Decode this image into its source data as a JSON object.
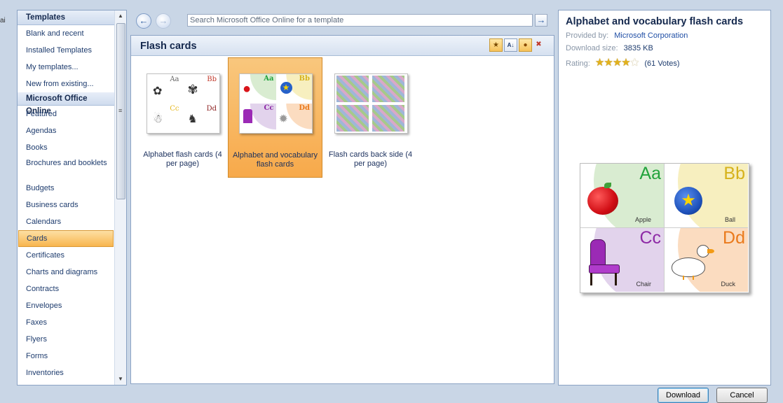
{
  "edge_text": "ai",
  "sidebar": {
    "header": "Templates",
    "items": [
      {
        "label": "Blank and recent"
      },
      {
        "label": "Installed Templates"
      },
      {
        "label": "My templates..."
      },
      {
        "label": "New from existing..."
      }
    ],
    "online_header": "Microsoft Office Online",
    "online_items": [
      {
        "label": "Featured"
      },
      {
        "label": "Agendas"
      },
      {
        "label": "Books"
      },
      {
        "label": "Brochures and booklets"
      },
      {
        "label": "Budgets"
      },
      {
        "label": "Business cards"
      },
      {
        "label": "Calendars"
      },
      {
        "label": "Cards",
        "selected": true
      },
      {
        "label": "Certificates"
      },
      {
        "label": "Charts and diagrams"
      },
      {
        "label": "Contracts"
      },
      {
        "label": "Envelopes"
      },
      {
        "label": "Faxes"
      },
      {
        "label": "Flyers"
      },
      {
        "label": "Forms"
      },
      {
        "label": "Inventories"
      }
    ]
  },
  "search": {
    "placeholder": "Search Microsoft Office Online for a template"
  },
  "gallery": {
    "title": "Flash cards",
    "templates": [
      {
        "label": "Alphabet flash cards (4 per page)",
        "selected": false
      },
      {
        "label": "Alphabet and vocabulary flash cards",
        "selected": true
      },
      {
        "label": "Flash cards back side (4 per page)",
        "selected": false
      }
    ]
  },
  "detail": {
    "title": "Alphabet and vocabulary flash cards",
    "provided_by_label": "Provided by:",
    "provided_by": "Microsoft Corporation",
    "download_size_label": "Download size:",
    "download_size": "3835 KB",
    "rating_label": "Rating:",
    "rating_value": 4,
    "rating_max": 5,
    "votes": "(61 Votes)",
    "preview_cards": [
      {
        "letter": "Aa",
        "word": "Apple",
        "color": "#22a33c",
        "arc": "#d9ecd1"
      },
      {
        "letter": "Bb",
        "word": "Ball",
        "color": "#d6b21c",
        "arc": "#f7efbf"
      },
      {
        "letter": "Cc",
        "word": "Chair",
        "color": "#8d2aa6",
        "arc": "#e2d3ec"
      },
      {
        "letter": "Dd",
        "word": "Duck",
        "color": "#ea7a1c",
        "arc": "#fbdcc0"
      }
    ]
  },
  "buttons": {
    "download": "Download",
    "cancel": "Cancel"
  }
}
